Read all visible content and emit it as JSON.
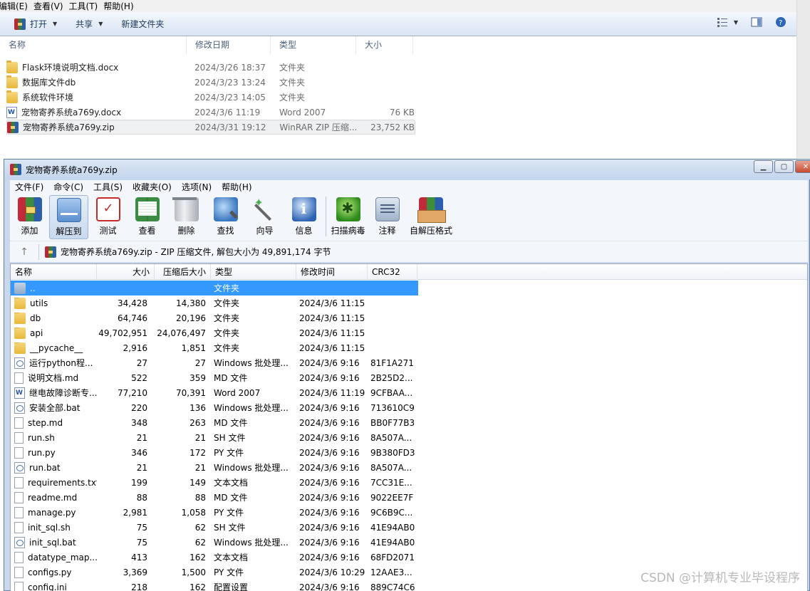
{
  "explorer": {
    "menu": [
      "编辑(E)",
      "查看(V)",
      "工具(T)",
      "帮助(H)"
    ],
    "toolbar": {
      "open": "打开",
      "share": "共享",
      "new_folder": "新建文件夹"
    },
    "columns": [
      "名称",
      "修改日期",
      "类型",
      "大小"
    ],
    "rows": [
      {
        "icon": "folder-icon",
        "name": "Flask环境说明文档.docx",
        "date": "2024/3/26 18:37",
        "type": "文件夹",
        "size": ""
      },
      {
        "icon": "folder-icon",
        "name": "数据库文件db",
        "date": "2024/3/23 13:24",
        "type": "文件夹",
        "size": ""
      },
      {
        "icon": "folder-icon",
        "name": "系统软件环境",
        "date": "2024/3/23 14:05",
        "type": "文件夹",
        "size": ""
      },
      {
        "icon": "word-doc-icon",
        "name": "宠物寄养系统a769y.docx",
        "date": "2024/3/6 11:19",
        "type": "Word 2007",
        "size": "76 KB"
      },
      {
        "icon": "winrar-zip-icon",
        "name": "宠物寄养系统a769y.zip",
        "date": "2024/3/31 19:12",
        "type": "WinRAR ZIP 压缩...",
        "size": "23,752 KB"
      }
    ]
  },
  "winrar": {
    "title": "宠物寄养系统a769y.zip",
    "menu": [
      "文件(F)",
      "命令(C)",
      "工具(S)",
      "收藏夹(O)",
      "选项(N)",
      "帮助(H)"
    ],
    "toolbar": {
      "add": "添加",
      "extract": "解压到",
      "test": "测试",
      "view": "查看",
      "delete": "删除",
      "find": "查找",
      "wizard": "向导",
      "info": "信息",
      "scan": "扫描病毒",
      "comment": "注释",
      "sfx": "自解压格式"
    },
    "path_text": "宠物寄养系统a769y.zip - ZIP 压缩文件, 解包大小为 49,891,174 字节",
    "columns": [
      "名称",
      "大小",
      "压缩后大小",
      "类型",
      "修改时间",
      "CRC32"
    ],
    "rows": [
      {
        "icon": "parent-folder-icon",
        "name": "..",
        "size": "",
        "packed": "",
        "type": "文件夹",
        "modified": "",
        "crc": ""
      },
      {
        "icon": "folder-icon",
        "name": "utils",
        "size": "34,428",
        "packed": "14,380",
        "type": "文件夹",
        "modified": "2024/3/6 11:15",
        "crc": ""
      },
      {
        "icon": "folder-icon",
        "name": "db",
        "size": "64,746",
        "packed": "20,196",
        "type": "文件夹",
        "modified": "2024/3/6 11:15",
        "crc": ""
      },
      {
        "icon": "folder-icon",
        "name": "api",
        "size": "49,702,951",
        "packed": "24,076,497",
        "type": "文件夹",
        "modified": "2024/3/6 11:15",
        "crc": ""
      },
      {
        "icon": "folder-icon",
        "name": "__pycache__",
        "size": "2,916",
        "packed": "1,851",
        "type": "文件夹",
        "modified": "2024/3/6 11:15",
        "crc": ""
      },
      {
        "icon": "batch-file-icon",
        "name": "运行python程...",
        "size": "27",
        "packed": "27",
        "type": "Windows 批处理...",
        "modified": "2024/3/6 9:16",
        "crc": "81F1A271"
      },
      {
        "icon": "text-file-icon",
        "name": "说明文档.md",
        "size": "522",
        "packed": "359",
        "type": "MD 文件",
        "modified": "2024/3/6 9:16",
        "crc": "2B25D2..."
      },
      {
        "icon": "word-doc-icon",
        "name": "继电故障诊断专...",
        "size": "77,210",
        "packed": "70,391",
        "type": "Word 2007",
        "modified": "2024/3/6 11:19",
        "crc": "9CFBAA..."
      },
      {
        "icon": "batch-file-icon",
        "name": "安装全部.bat",
        "size": "220",
        "packed": "136",
        "type": "Windows 批处理...",
        "modified": "2024/3/6 9:16",
        "crc": "713610C9"
      },
      {
        "icon": "text-file-icon",
        "name": "step.md",
        "size": "348",
        "packed": "263",
        "type": "MD 文件",
        "modified": "2024/3/6 9:16",
        "crc": "BB0F77B3"
      },
      {
        "icon": "text-file-icon",
        "name": "run.sh",
        "size": "21",
        "packed": "21",
        "type": "SH 文件",
        "modified": "2024/3/6 9:16",
        "crc": "8A507A..."
      },
      {
        "icon": "text-file-icon",
        "name": "run.py",
        "size": "346",
        "packed": "172",
        "type": "PY 文件",
        "modified": "2024/3/6 9:16",
        "crc": "9B380FD3"
      },
      {
        "icon": "batch-file-icon",
        "name": "run.bat",
        "size": "21",
        "packed": "21",
        "type": "Windows 批处理...",
        "modified": "2024/3/6 9:16",
        "crc": "8A507A..."
      },
      {
        "icon": "text-file-icon",
        "name": "requirements.txt",
        "size": "199",
        "packed": "149",
        "type": "文本文档",
        "modified": "2024/3/6 9:16",
        "crc": "7CC31E..."
      },
      {
        "icon": "text-file-icon",
        "name": "readme.md",
        "size": "88",
        "packed": "88",
        "type": "MD 文件",
        "modified": "2024/3/6 9:16",
        "crc": "9022EE7F"
      },
      {
        "icon": "text-file-icon",
        "name": "manage.py",
        "size": "2,981",
        "packed": "1,058",
        "type": "PY 文件",
        "modified": "2024/3/6 9:16",
        "crc": "9C6B9C..."
      },
      {
        "icon": "text-file-icon",
        "name": "init_sql.sh",
        "size": "75",
        "packed": "62",
        "type": "SH 文件",
        "modified": "2024/3/6 9:16",
        "crc": "41E94AB0"
      },
      {
        "icon": "batch-file-icon",
        "name": "init_sql.bat",
        "size": "75",
        "packed": "62",
        "type": "Windows 批处理...",
        "modified": "2024/3/6 9:16",
        "crc": "41E94AB0"
      },
      {
        "icon": "text-file-icon",
        "name": "datatype_map....",
        "size": "413",
        "packed": "162",
        "type": "文本文档",
        "modified": "2024/3/6 9:16",
        "crc": "68FD2071"
      },
      {
        "icon": "text-file-icon",
        "name": "configs.py",
        "size": "3,369",
        "packed": "1,500",
        "type": "PY 文件",
        "modified": "2024/3/6 10:29",
        "crc": "12AAE3..."
      },
      {
        "icon": "text-file-icon",
        "name": "config.ini",
        "size": "218",
        "packed": "162",
        "type": "配置设置",
        "modified": "2024/3/6 9:16",
        "crc": "889C74C6"
      }
    ]
  },
  "watermark": "CSDN @计算机专业毕设程序",
  "colors": {
    "selection": "#3399ff",
    "title_bar": "#c4d5eb",
    "explorer_selection": "#eef0f2"
  }
}
